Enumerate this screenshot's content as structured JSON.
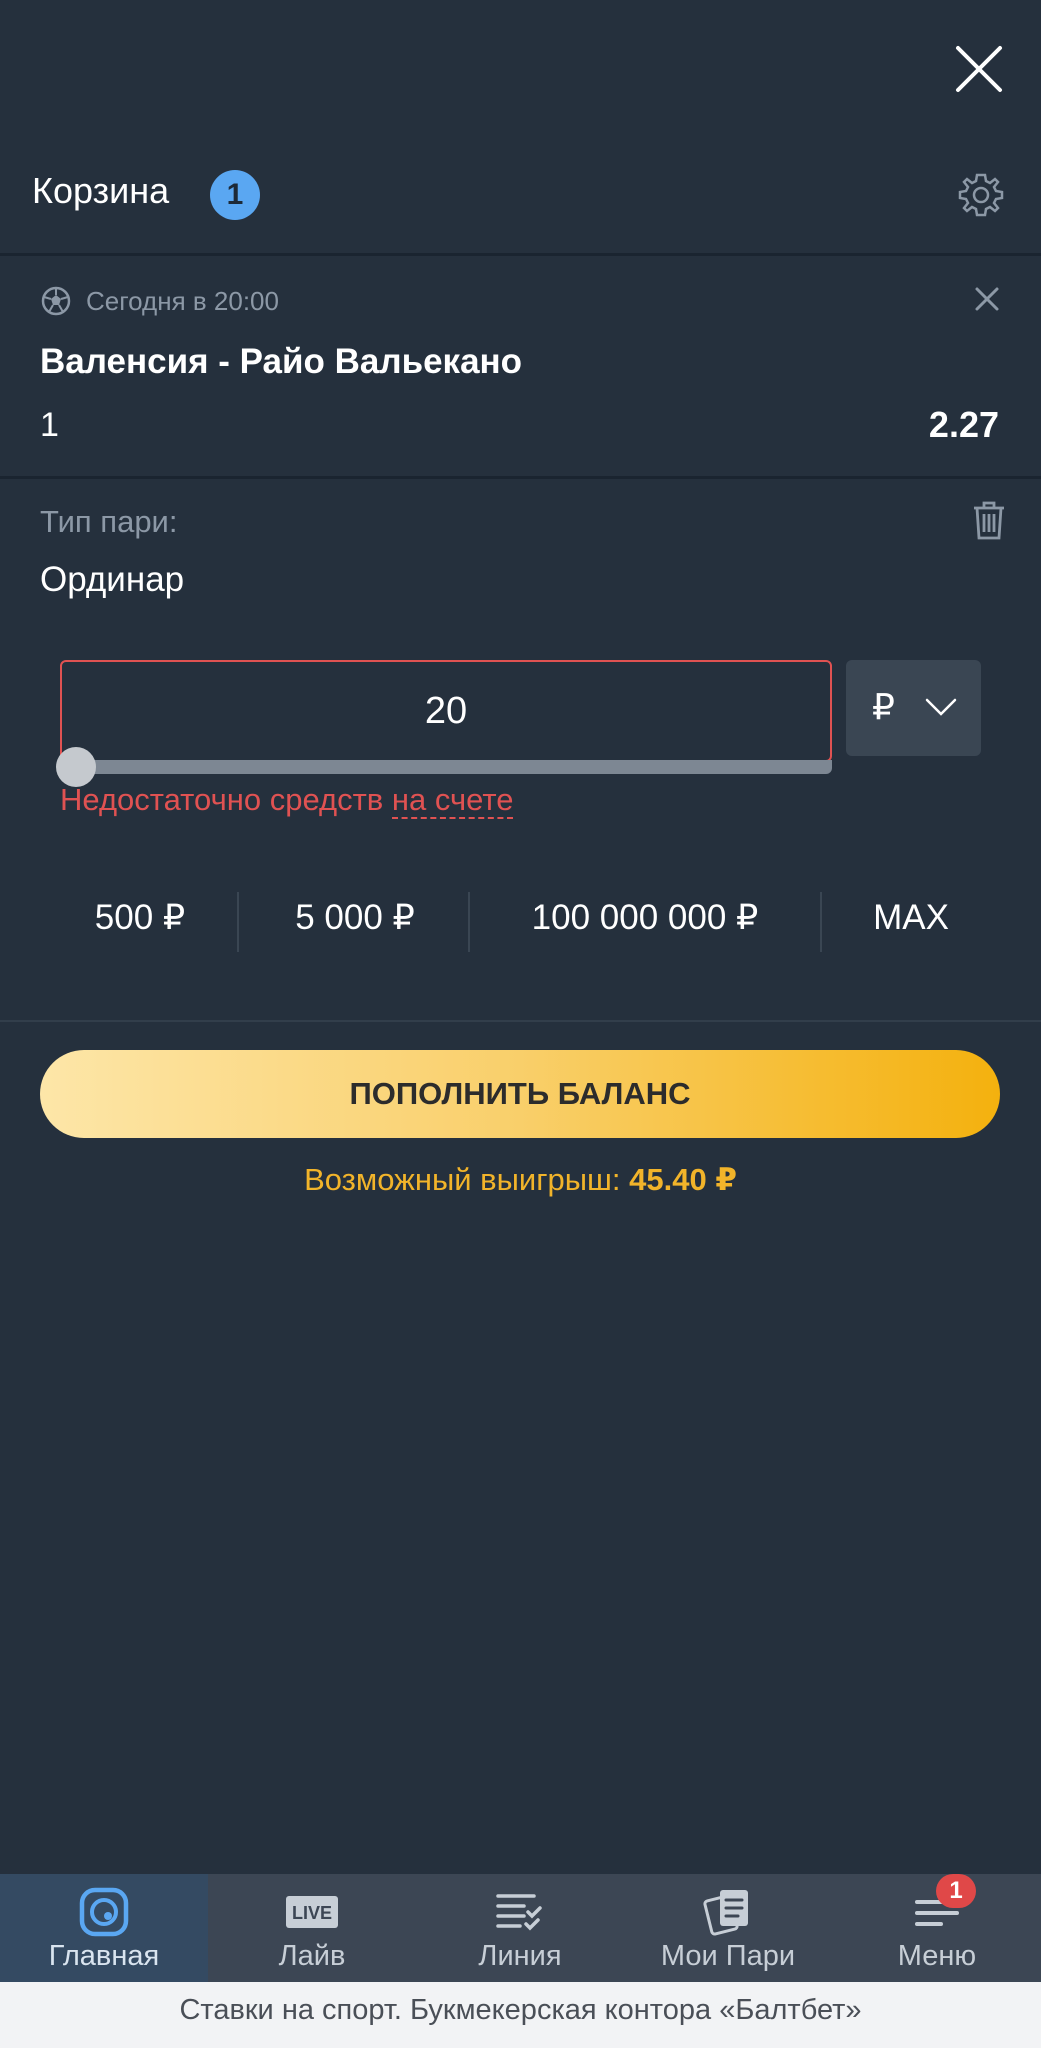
{
  "header": {
    "title": "Корзина",
    "badge": "1"
  },
  "event": {
    "time": "Сегодня в 20:00",
    "name": "Валенсия - Райо Вальекано",
    "outcome": "1",
    "odds": "2.27"
  },
  "bet_type": {
    "label": "Тип пари:",
    "value": "Ординар"
  },
  "stake": {
    "value": "20",
    "currency": "₽",
    "error_prefix": "Недостаточно средств ",
    "error_link": "на счете",
    "slider_fraction": 0.0
  },
  "quick_amounts": [
    "500 ₽",
    "5 000 ₽",
    "100 000 000 ₽",
    "MAX"
  ],
  "topup_button": "ПОПОЛНИТЬ БАЛАНС",
  "potential_win": {
    "label": "Возможный выигрыш: ",
    "value": "45.40 ₽"
  },
  "nav": {
    "items": [
      {
        "label": "Главная",
        "icon": "home-ball-icon"
      },
      {
        "label": "Лайв",
        "icon": "live-icon",
        "icon_text": "LIVE"
      },
      {
        "label": "Линия",
        "icon": "line-list-icon"
      },
      {
        "label": "Мои Пари",
        "icon": "my-bets-icon"
      },
      {
        "label": "Меню",
        "icon": "menu-icon"
      }
    ],
    "menu_badge": "1"
  },
  "footer": "Ставки на спорт. Букмекерская контора «Балтбет»",
  "colors": {
    "background": "#25303d",
    "accent_blue": "#5aa7f2",
    "error_red": "#e05252",
    "gold": "#f2b42a"
  }
}
